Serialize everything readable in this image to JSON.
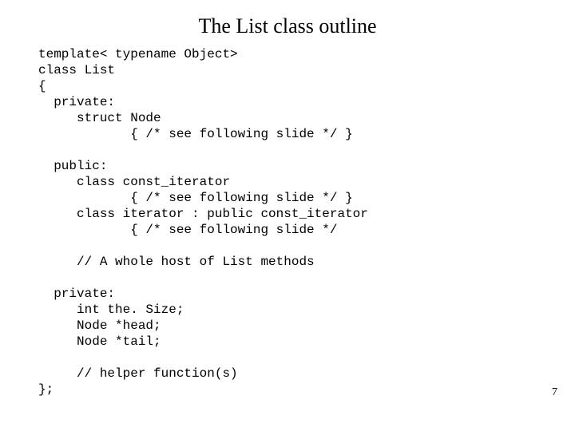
{
  "title": "The List class outline",
  "code": {
    "l1": "template< typename Object>",
    "l2": "class List",
    "l3": "{",
    "l4": "  private:",
    "l5": "     struct Node",
    "l6": "            { /* see following slide */ }",
    "l7": "",
    "l8": "  public:",
    "l9": "     class const_iterator",
    "l10": "            { /* see following slide */ }",
    "l11": "     class iterator : public const_iterator",
    "l12": "            { /* see following slide */",
    "l13": "",
    "l14": "     // A whole host of List methods",
    "l15": "",
    "l16": "  private:",
    "l17": "     int the. Size;",
    "l18": "     Node *head;",
    "l19": "     Node *tail;",
    "l20": "",
    "l21": "     // helper function(s)",
    "l22": "};"
  },
  "page_number": "7"
}
